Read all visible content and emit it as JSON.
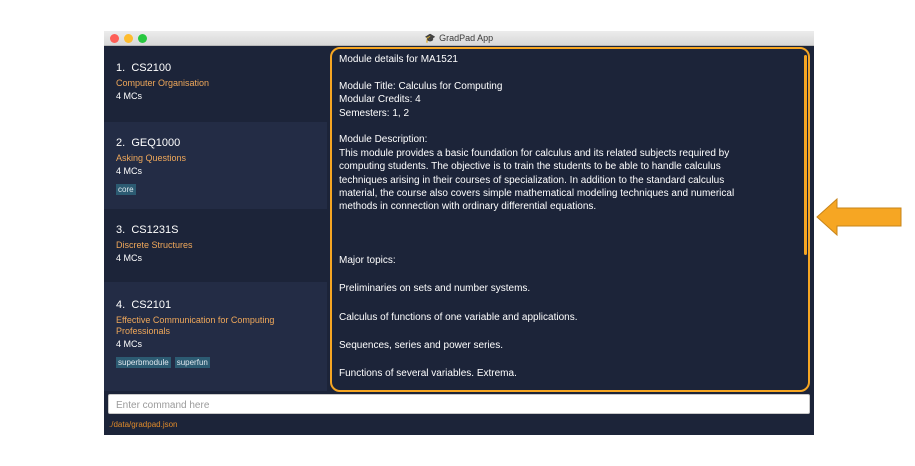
{
  "window": {
    "title": "GradPad App",
    "title_icon": "graduation-cap-icon"
  },
  "modules": [
    {
      "index": "1.",
      "code": "CS2100",
      "title": "Computer Organisation",
      "credits": "4 MCs",
      "tags": []
    },
    {
      "index": "2.",
      "code": "GEQ1000",
      "title": "Asking Questions",
      "credits": "4 MCs",
      "tags": [
        "core"
      ]
    },
    {
      "index": "3.",
      "code": "CS1231S",
      "title": "Discrete Structures",
      "credits": "4 MCs",
      "tags": []
    },
    {
      "index": "4.",
      "code": "CS2101",
      "title": "Effective Communication for Computing",
      "title_line2": "Professionals",
      "credits": "4 MCs",
      "tags": [
        "superbmodule",
        "superfun"
      ]
    }
  ],
  "details": {
    "heading": "Module details for MA1521",
    "title_line": "Module Title: Calculus for Computing",
    "credits_line": "Modular Credits: 4",
    "semesters_line": "Semesters: 1, 2",
    "desc_label": "Module Description:",
    "desc_lines": [
      "This module provides a basic foundation for calculus and its related subjects required by",
      "computing students. The objective is to train the students to be able to handle calculus",
      "techniques arising in their courses of specialization. In addition to the standard calculus",
      "material, the course also covers simple mathematical modeling techniques and numerical",
      "methods in connection with ordinary differential equations."
    ],
    "topics_label": "Major topics:",
    "topics": [
      "Preliminaries on sets and number systems.",
      "Calculus of functions of one variable and applications.",
      "Sequences, series and power series.",
      "Functions of several variables. Extrema."
    ]
  },
  "command": {
    "placeholder": "Enter command here",
    "value": ""
  },
  "status": {
    "path": "./data/gradpad.json"
  },
  "colors": {
    "background": "#1c2439",
    "card_alt": "#232c45",
    "accent": "#f6a623",
    "module_title": "#f0a85a",
    "tag": "#2c5b72",
    "status_text": "#e08a2a"
  },
  "annotation": {
    "icon": "arrow-left-icon",
    "color": "#f6a623"
  }
}
